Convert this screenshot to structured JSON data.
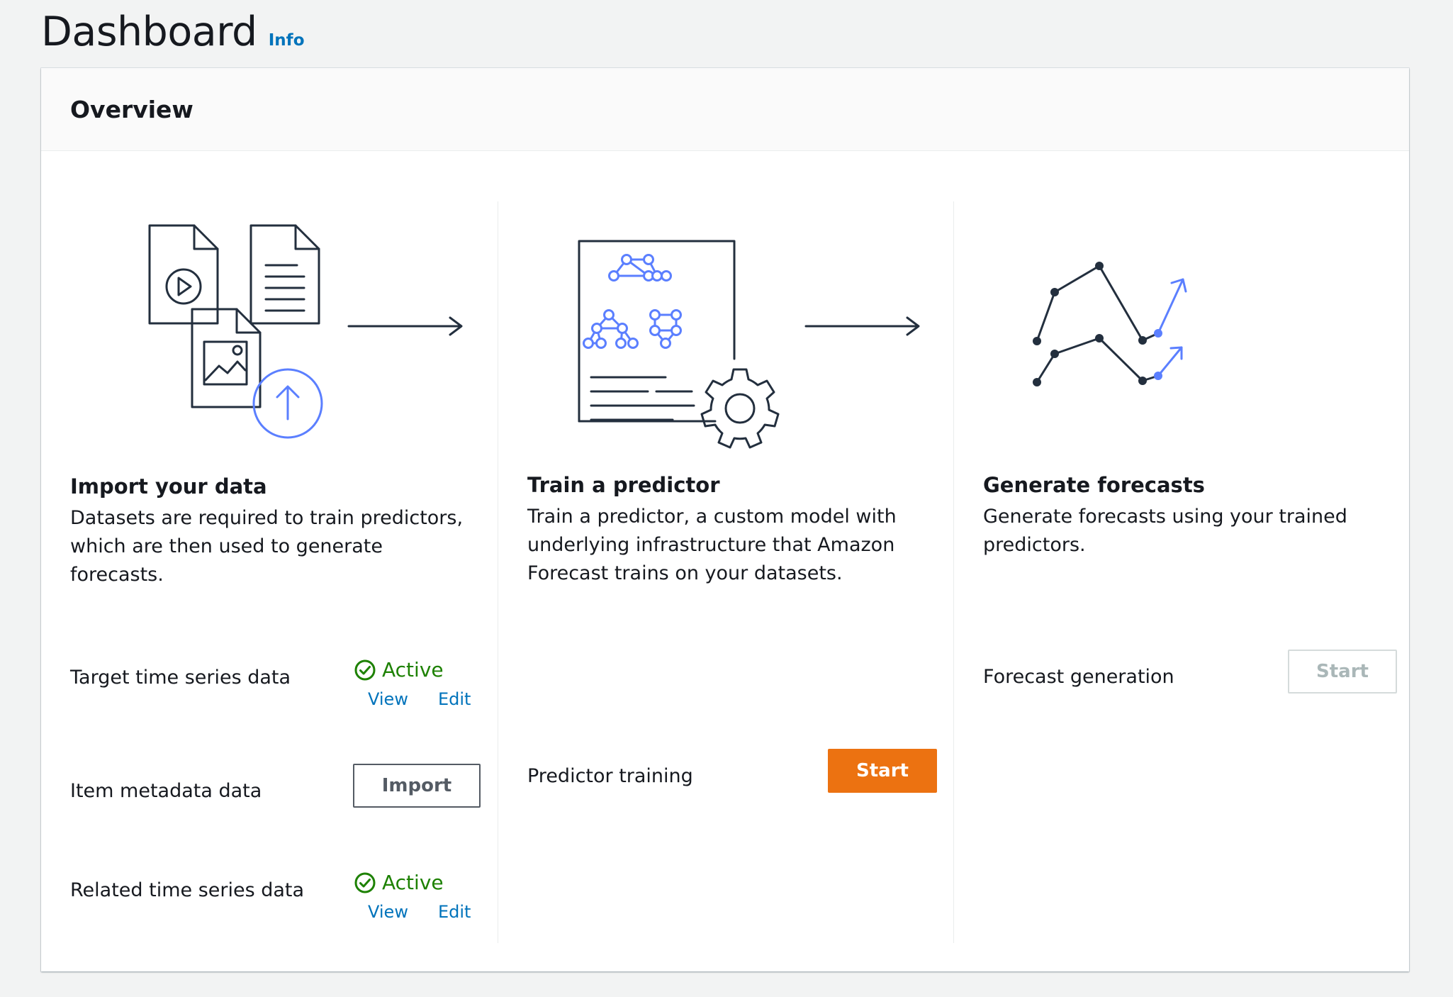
{
  "page": {
    "title": "Dashboard",
    "info_link": "Info"
  },
  "overview": {
    "title": "Overview",
    "steps": [
      {
        "title": "Import your data",
        "description": "Datasets are required to train predictors, which are then used to generate forecasts.",
        "rows": [
          {
            "label": "Target time series data",
            "status": "Active",
            "view": "View",
            "edit": "Edit"
          },
          {
            "label": "Item metadata data",
            "button": "Import"
          },
          {
            "label": "Related time series data",
            "status": "Active",
            "view": "View",
            "edit": "Edit"
          }
        ]
      },
      {
        "title": "Train a predictor",
        "description": "Train a predictor, a custom model with underlying infrastructure that Amazon Forecast trains on your datasets.",
        "row": {
          "label": "Predictor training",
          "button": "Start"
        }
      },
      {
        "title": "Generate forecasts",
        "description": "Generate forecasts using your trained predictors.",
        "row": {
          "label": "Forecast generation",
          "button": "Start"
        }
      }
    ]
  },
  "colors": {
    "primary": "#ec7211",
    "link": "#0073bb",
    "success": "#1d8102",
    "illustration_accent": "#5b7fff",
    "illustration_line": "#232f3e",
    "disabled": "#aab7b8"
  }
}
